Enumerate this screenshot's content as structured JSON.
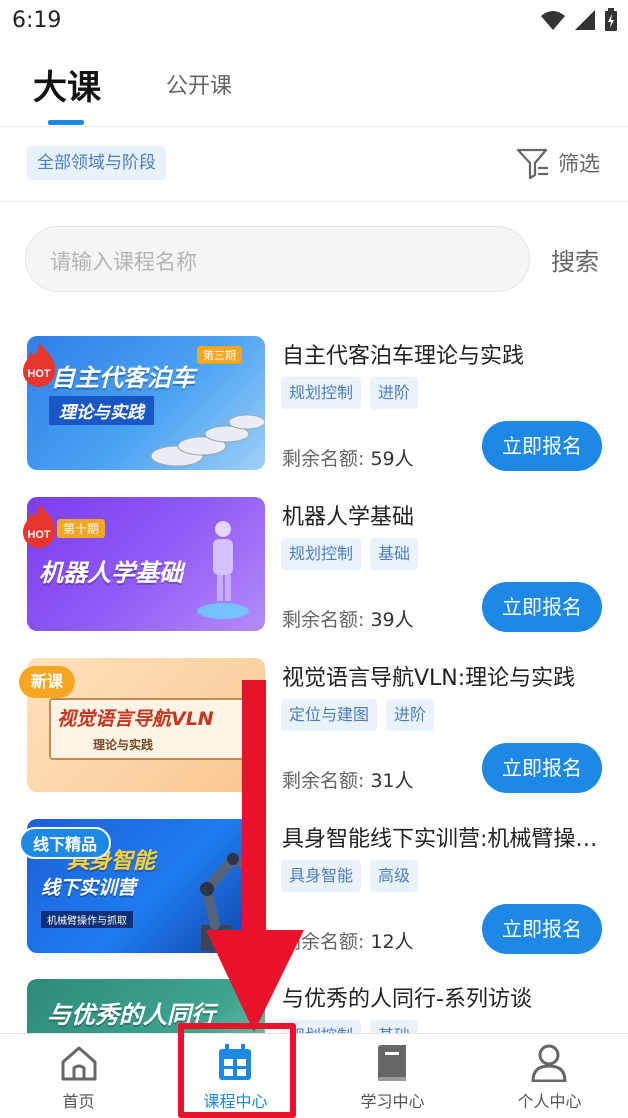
{
  "status_bar": {
    "time": "6:19"
  },
  "tabs": {
    "main": "大课",
    "open": "公开课"
  },
  "filters": {
    "all_label": "全部领域与阶段",
    "filter_label": "筛选"
  },
  "search": {
    "placeholder": "请输入课程名称",
    "button": "搜索"
  },
  "remain_label": "剩余名额:",
  "courses": [
    {
      "title": "自主代客泊车理论与实践",
      "tags": [
        "规划控制",
        "进阶"
      ],
      "remain": "59人",
      "button": "立即报名",
      "badge": "HOT",
      "thumb_title": "自主代客泊车",
      "thumb_sub": "理论与实践",
      "thumb_period": "第三期"
    },
    {
      "title": "机器人学基础",
      "tags": [
        "规划控制",
        "基础"
      ],
      "remain": "39人",
      "button": "立即报名",
      "badge": "HOT",
      "thumb_title": "机器人学基础",
      "thumb_period": "第十期"
    },
    {
      "title": "视觉语言导航VLN:理论与实践",
      "tags": [
        "定位与建图",
        "进阶"
      ],
      "remain": "31人",
      "button": "立即报名",
      "badge": "新课",
      "thumb_title": "视觉语言导航VLN",
      "thumb_sub": "理论与实践"
    },
    {
      "title": "具身智能线下实训营:机械臂操作与抓取",
      "tags": [
        "具身智能",
        "高级"
      ],
      "remain": "12人",
      "button": "立即报名",
      "badge": "线下精品",
      "thumb_title": "具身智能",
      "thumb_sub": "线下实训营",
      "thumb_caption": "机械臂操作与抓取"
    },
    {
      "title": "与优秀的人同行-系列访谈",
      "tags": [
        "规划控制",
        "基础"
      ],
      "thumb_title": "与优秀的人同行"
    }
  ],
  "nav": [
    {
      "label": "首页",
      "icon": "home-icon"
    },
    {
      "label": "课程中心",
      "icon": "calendar-icon",
      "active": true
    },
    {
      "label": "学习中心",
      "icon": "book-icon"
    },
    {
      "label": "个人中心",
      "icon": "user-icon"
    }
  ],
  "colors": {
    "accent": "#1e88e5",
    "highlight": "#e8132a",
    "tag_bg": "#eaf2fc"
  }
}
